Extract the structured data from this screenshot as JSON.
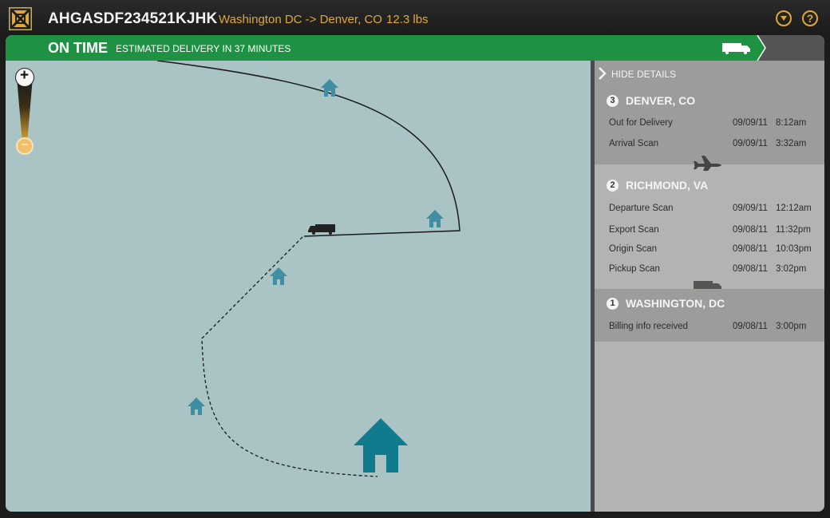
{
  "header": {
    "tracking_number": "AHGASDF234521KJHK",
    "route": "Washington DC -> Denver, CO",
    "weight": "12.3 lbs",
    "icons": [
      "package-logo-icon",
      "dropdown-icon",
      "help-icon"
    ],
    "help_label": "?"
  },
  "status": {
    "state": "ON TIME",
    "eta": "ESTIMATED DELIVERY IN 37 MINUTES",
    "color": "#1f9142",
    "icon": "truck-icon"
  },
  "map": {
    "background": "#aac3c4",
    "zoom_in": "+",
    "zoom_out": "−",
    "icons": [
      "house-icon",
      "truck-icon",
      "destination-house-icon"
    ]
  },
  "panel": {
    "hide_details": "HIDE DETAILS",
    "stops": [
      {
        "number": "3",
        "city": "DENVER, CO",
        "events": [
          {
            "desc": "Out for Delivery",
            "date": "09/09/11",
            "time": "8:12am"
          },
          {
            "desc": "Arrival Scan",
            "date": "09/09/11",
            "time": "3:32am"
          }
        ]
      },
      {
        "number": "2",
        "city": "RICHMOND, VA",
        "events": [
          {
            "desc": "Departure Scan",
            "date": "09/09/11",
            "time": "12:12am"
          },
          {
            "desc": "Export Scan",
            "date": "09/08/11",
            "time": "11:32pm"
          },
          {
            "desc": "Origin Scan",
            "date": "09/08/11",
            "time": "10:03pm"
          },
          {
            "desc": "Pickup Scan",
            "date": "09/08/11",
            "time": "3:02pm"
          }
        ]
      },
      {
        "number": "1",
        "city": "WASHINGTON, DC",
        "events": [
          {
            "desc": "Billing info received",
            "date": "09/08/11",
            "time": "3:00pm"
          }
        ]
      }
    ],
    "transit_icons": [
      "airplane-icon",
      "truck-icon"
    ]
  },
  "colors": {
    "accent": "#e0a833",
    "on_time_green": "#1f9142",
    "house_blue": "#3f8ea1",
    "destination_blue": "#117b8e"
  }
}
